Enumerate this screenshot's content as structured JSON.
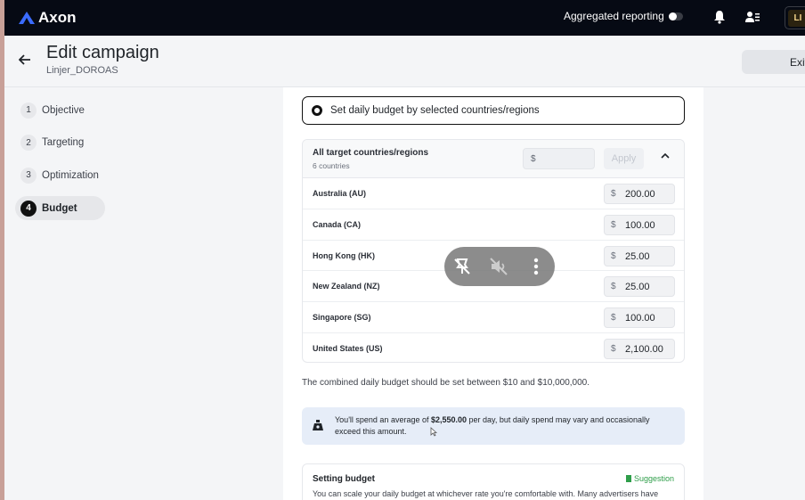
{
  "app": {
    "name": "Axon"
  },
  "topbar": {
    "aggregated_label": "Aggregated reporting",
    "avatar_initials": "LI"
  },
  "header": {
    "title": "Edit campaign",
    "subtitle": "Linjer_DOROAS",
    "exit_label": "Exit"
  },
  "steps": [
    {
      "num": "1",
      "label": "Objective"
    },
    {
      "num": "2",
      "label": "Targeting"
    },
    {
      "num": "3",
      "label": "Optimization"
    },
    {
      "num": "4",
      "label": "Budget",
      "active": true
    }
  ],
  "budget": {
    "option_label": "Set daily budget by selected countries/regions",
    "all_label": "All target countries/regions",
    "count_label": "6 countries",
    "currency": "$",
    "apply_label": "Apply",
    "rows": [
      {
        "name": "Australia (AU)",
        "value": "200.00"
      },
      {
        "name": "Canada (CA)",
        "value": "100.00"
      },
      {
        "name": "Hong Kong (HK)",
        "value": "25.00"
      },
      {
        "name": "New Zealand (NZ)",
        "value": "25.00"
      },
      {
        "name": "Singapore (SG)",
        "value": "100.00"
      },
      {
        "name": "United States (US)",
        "value": "2,100.00"
      }
    ],
    "note": "The combined daily budget should be set between $10 and $10,000,000.",
    "info_pre": "You'll spend an average of ",
    "info_amount": "$2,550.00",
    "info_post": " per day, but daily spend may vary and occasionally exceed this amount."
  },
  "setting": {
    "title": "Setting budget",
    "suggestion": "Suggestion",
    "desc": "You can scale your daily budget at whichever rate you're comfortable with. Many advertisers have"
  }
}
